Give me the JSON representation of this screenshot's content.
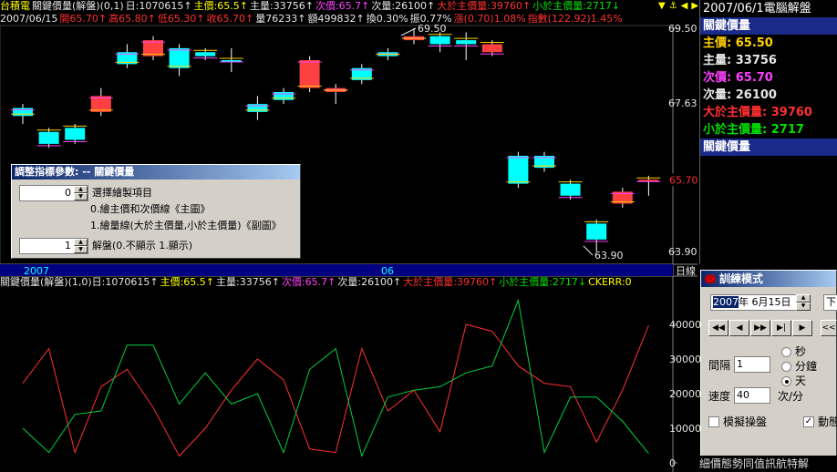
{
  "header1": [
    {
      "text": "台積電",
      "color": "#ffff00"
    },
    {
      "text": "關鍵價量(解盤)(0,1)",
      "color": "#e6e6e6"
    },
    {
      "text": "日:1070615↑",
      "color": "#e6e6e6"
    },
    {
      "text": "主價:65.5↑",
      "color": "#ffff00"
    },
    {
      "text": "主量:33756↑",
      "color": "#e6e6e6"
    },
    {
      "text": "次價:65.7↑",
      "color": "#ff40ff"
    },
    {
      "text": "次量:26100↑",
      "color": "#e6e6e6"
    },
    {
      "text": "大於主價量:39760↑",
      "color": "#ff3030"
    },
    {
      "text": "小於主價量:2717↓",
      "color": "#00e000"
    }
  ],
  "header2": [
    {
      "text": "2007/06/15",
      "color": "#e6e6e6"
    },
    {
      "text": "開65.70↑",
      "color": "#ff3030"
    },
    {
      "text": "高65.80↑",
      "color": "#ff3030"
    },
    {
      "text": "低65.30↑",
      "color": "#ff3030"
    },
    {
      "text": "收65.70↑",
      "color": "#ff3030"
    },
    {
      "text": "量76233↑",
      "color": "#e6e6e6"
    },
    {
      "text": "額499832↑",
      "color": "#e6e6e6"
    },
    {
      "text": "換0.30%",
      "color": "#e6e6e6"
    },
    {
      "text": "振0.77%",
      "color": "#e6e6e6"
    },
    {
      "text": "漲(0.70)1.08%",
      "color": "#ff3030"
    },
    {
      "text": "指數(122.92)1.45%",
      "color": "#ff3030"
    }
  ],
  "price_axis": {
    "labels": [
      "69.50",
      "67.63",
      "65.70",
      "63.90"
    ],
    "current": "65.70",
    "high_note": "69.50",
    "low_note": "63.90"
  },
  "date_axis": {
    "labels": [
      "2007",
      "06"
    ],
    "right_label": "日線"
  },
  "candles": [
    {
      "o": 67.3,
      "c": 67.5,
      "h": 67.6,
      "l": 67.1,
      "up": false
    },
    {
      "o": 66.9,
      "c": 66.6,
      "h": 67.0,
      "l": 66.5,
      "up": false
    },
    {
      "o": 67.0,
      "c": 66.7,
      "h": 67.1,
      "l": 66.6,
      "up": false
    },
    {
      "o": 67.4,
      "c": 67.8,
      "h": 68.0,
      "l": 67.3,
      "up": true
    },
    {
      "o": 68.6,
      "c": 68.9,
      "h": 69.1,
      "l": 68.5,
      "up": false
    },
    {
      "o": 68.8,
      "c": 69.2,
      "h": 69.3,
      "l": 68.7,
      "up": true
    },
    {
      "o": 68.5,
      "c": 69.0,
      "h": 69.1,
      "l": 68.3,
      "up": false
    },
    {
      "o": 68.9,
      "c": 68.8,
      "h": 69.0,
      "l": 68.7,
      "up": false
    },
    {
      "o": 68.7,
      "c": 68.7,
      "h": 69.0,
      "l": 68.4,
      "up": false
    },
    {
      "o": 67.4,
      "c": 67.6,
      "h": 67.8,
      "l": 67.2,
      "up": false
    },
    {
      "o": 67.7,
      "c": 67.9,
      "h": 68.0,
      "l": 67.6,
      "up": false
    },
    {
      "o": 68.0,
      "c": 68.7,
      "h": 68.8,
      "l": 67.9,
      "up": true
    },
    {
      "o": 67.9,
      "c": 68.0,
      "h": 68.1,
      "l": 67.6,
      "up": true
    },
    {
      "o": 68.2,
      "c": 68.5,
      "h": 68.6,
      "l": 68.1,
      "up": false
    },
    {
      "o": 68.8,
      "c": 68.9,
      "h": 69.0,
      "l": 68.7,
      "up": false
    },
    {
      "o": 69.2,
      "c": 69.3,
      "h": 69.5,
      "l": 69.1,
      "up": true
    },
    {
      "o": 69.3,
      "c": 69.1,
      "h": 69.4,
      "l": 68.9,
      "up": false
    },
    {
      "o": 69.2,
      "c": 69.1,
      "h": 69.4,
      "l": 68.7,
      "up": false
    },
    {
      "o": 69.1,
      "c": 68.9,
      "h": 69.2,
      "l": 68.8,
      "up": true
    },
    {
      "o": 65.6,
      "c": 66.3,
      "h": 66.4,
      "l": 65.5,
      "up": false
    },
    {
      "o": 66.0,
      "c": 66.3,
      "h": 66.4,
      "l": 65.9,
      "up": false
    },
    {
      "o": 65.6,
      "c": 65.3,
      "h": 65.7,
      "l": 65.2,
      "up": false
    },
    {
      "o": 64.6,
      "c": 64.2,
      "h": 64.7,
      "l": 63.9,
      "up": false
    },
    {
      "o": 65.1,
      "c": 65.4,
      "h": 65.5,
      "l": 65.0,
      "up": true
    },
    {
      "o": 65.7,
      "c": 65.7,
      "h": 65.8,
      "l": 65.3,
      "up": true
    }
  ],
  "indicator": {
    "title": "關鍵價量(解盤)(1,0)",
    "labels": [
      {
        "text": "日:1070615↑",
        "color": "#e6e6e6"
      },
      {
        "text": "主價:65.5↑",
        "color": "#ffff00"
      },
      {
        "text": "主量:33756↑",
        "color": "#e6e6e6"
      },
      {
        "text": "次價:65.7↑",
        "color": "#ff40ff"
      },
      {
        "text": "次量:26100↑",
        "color": "#e6e6e6"
      },
      {
        "text": "大於主價量:39760↑",
        "color": "#ff3030"
      },
      {
        "text": "小於主價量:2717↓",
        "color": "#00e000"
      },
      {
        "text": "CKERR:0",
        "color": "#ffff00"
      }
    ],
    "y_labels": [
      "40000",
      "30000",
      "20000",
      "10000",
      "0"
    ],
    "red_series": [
      23000,
      33000,
      3000,
      22000,
      27000,
      16000,
      2000,
      10000,
      21000,
      30000,
      24000,
      4000,
      3000,
      33000,
      15000,
      21000,
      9000,
      40000,
      38000,
      28000,
      23000,
      22000,
      6000,
      21000,
      39700
    ],
    "green_series": [
      10000,
      3000,
      14000,
      15000,
      34000,
      34000,
      17000,
      26000,
      17000,
      20000,
      3000,
      27000,
      33000,
      2000,
      19000,
      21000,
      22000,
      26000,
      28000,
      47000,
      3000,
      19000,
      19000,
      12000,
      2700
    ],
    "ylim": [
      0,
      50000
    ]
  },
  "info_panel": {
    "date": "2007/06/1",
    "title_tail": "電腦解盤",
    "rows": [
      {
        "text": "關鍵價量",
        "color": "#ffffff",
        "selected": true
      },
      {
        "text": "主價: 65.50",
        "color": "#ffd000",
        "selected": false
      },
      {
        "text": "主量: 33756",
        "color": "#e6e6e6",
        "selected": false
      },
      {
        "text": "次價: 65.70",
        "color": "#ff40ff",
        "selected": false
      },
      {
        "text": "次量: 26100",
        "color": "#e6e6e6",
        "selected": false
      },
      {
        "text": "大於主價量: 39760",
        "color": "#ff3030",
        "selected": false
      },
      {
        "text": "小於主價量: 2717",
        "color": "#00e000",
        "selected": false
      },
      {
        "text": "關鍵價量",
        "color": "#ffffff",
        "selected": true
      }
    ]
  },
  "param_dialog": {
    "title": "調整指標參數: -- 關鍵價量",
    "field1_value": "0",
    "field1_label": "選擇繪製項目",
    "option0": "0.繪主價和次價線《主圖》",
    "option1": "1.繪量線(大於主價量,小於主價量)《副圖》",
    "field2_value": "1",
    "field2_label": "解盤(0.不顯示 1.顯示)"
  },
  "play_panel": {
    "title": "訓練模式",
    "date_year": "2007",
    "date_rest": "年  6月15日",
    "dropdown": "下",
    "nav_buttons": [
      "◀◀",
      "◀",
      "▶▶",
      "▶|",
      "▶"
    ],
    "extra_button": "<<",
    "interval_label": "間隔",
    "interval_value": "1",
    "speed_label": "速度",
    "speed_value": "40",
    "units": [
      "秒",
      "分鐘",
      "天"
    ],
    "unit_selected": 2,
    "speed_unit": "次/分",
    "simulate_label": "模擬操盤",
    "auto_label": "動態",
    "auto_checked": true
  },
  "bottom_text": "細價態勢同值訊航特解"
}
